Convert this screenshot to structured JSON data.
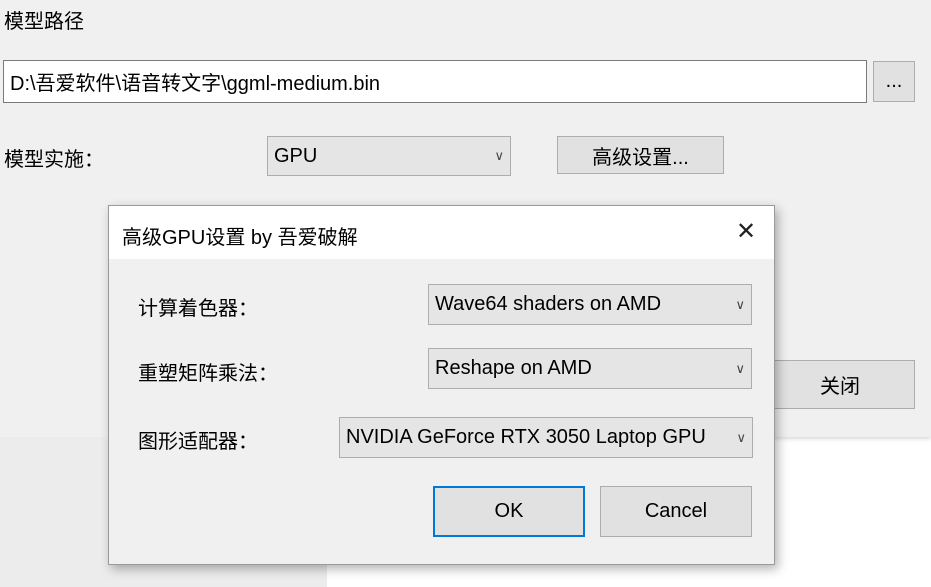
{
  "main": {
    "model_path_label": "模型路径",
    "model_path_value": "D:\\吾爱软件\\语音转文字\\ggml-medium.bin",
    "browse_label": "...",
    "impl_label": "模型实施：",
    "impl_value": "GPU",
    "advanced_label": "高级设置...",
    "close_label": "关闭"
  },
  "dialog": {
    "title": "高级GPU设置 by 吾爱破解",
    "close_icon": "close-icon",
    "rows": [
      {
        "label": "计算着色器：",
        "value": "Wave64 shaders on AMD"
      },
      {
        "label": "重塑矩阵乘法：",
        "value": "Reshape on AMD"
      },
      {
        "label": "图形适配器：",
        "value": "NVIDIA GeForce RTX 3050 Laptop GPU"
      }
    ],
    "ok_label": "OK",
    "cancel_label": "Cancel"
  },
  "colors": {
    "accent": "#0078d7",
    "window_bg": "#f0f0f0"
  }
}
